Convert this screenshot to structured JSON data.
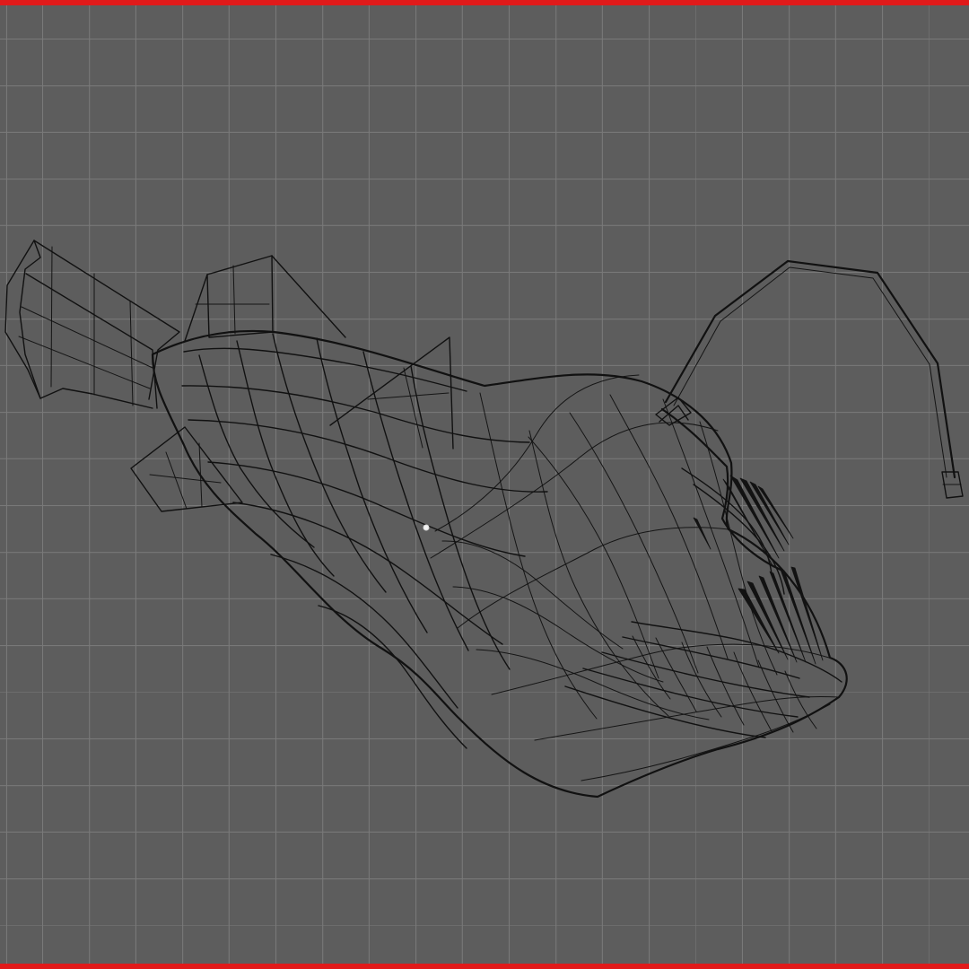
{
  "viewport": {
    "background": "#5d5d5d",
    "grid_color": "#7d7d7d",
    "frame_color": "#e01a1a"
  },
  "object": {
    "name": "anglerfish-wireframe-mesh"
  }
}
